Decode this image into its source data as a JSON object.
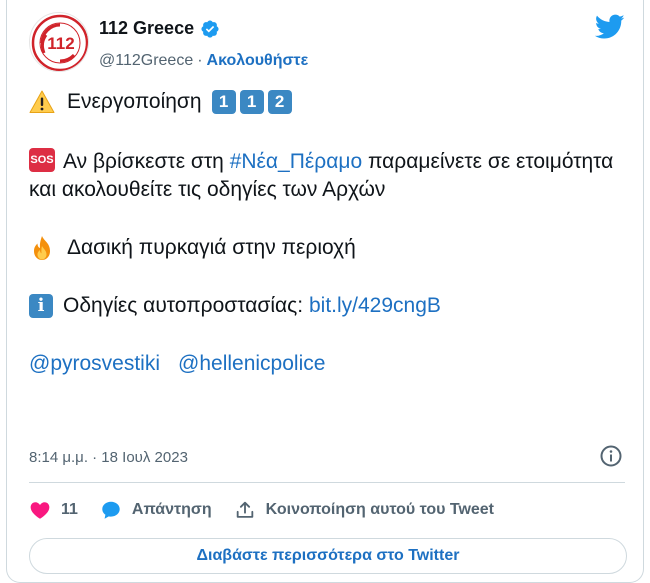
{
  "author": {
    "name": "112 Greece",
    "handle": "@112Greece",
    "separator": "·",
    "follow_label": "Ακολουθήστε",
    "avatar_text": "112",
    "avatar_ring_text": "ΕΥΡΩΠΑΪΚΟΣ ΑΡΙΘΜΟΣ ΕΚΤΑΚΤΗΣ ΑΝΑΓΚΗΣ"
  },
  "tweet": {
    "line1_text": "Ενεργοποίηση",
    "line1_keys": [
      "1",
      "1",
      "2"
    ],
    "sos_badge": "SOS",
    "line2_prefix": "Αν βρίσκεστε στη ",
    "line2_hashtag": "#Νέα_Πέραμο",
    "line2_suffix": " παραμείνετε σε ετοιμότητα και ακολουθείτε τις οδηγίες των Αρχών",
    "line3_text": "Δασική πυρκαγιά στην περιοχή",
    "info_badge": "i",
    "line4_text": "Οδηγίες αυτοπροστασίας: ",
    "line4_link": "bit.ly/429cngB",
    "mentions": [
      "@pyrosvestiki",
      "@hellenicpolice"
    ]
  },
  "meta": {
    "timestamp": "8:14 μ.μ. · 18 Ιουλ 2023"
  },
  "actions": {
    "likes_count": "11",
    "reply_label": "Απάντηση",
    "share_label": "Κοινοποίηση αυτού του Tweet"
  },
  "read_more_label": "Διαβάστε περισσότερα στο Twitter",
  "colors": {
    "link": "#1d70c2",
    "like": "#f91880",
    "twitter_blue": "#1d9bf0",
    "keycap": "#3b88c3",
    "sos": "#dd2e44"
  }
}
